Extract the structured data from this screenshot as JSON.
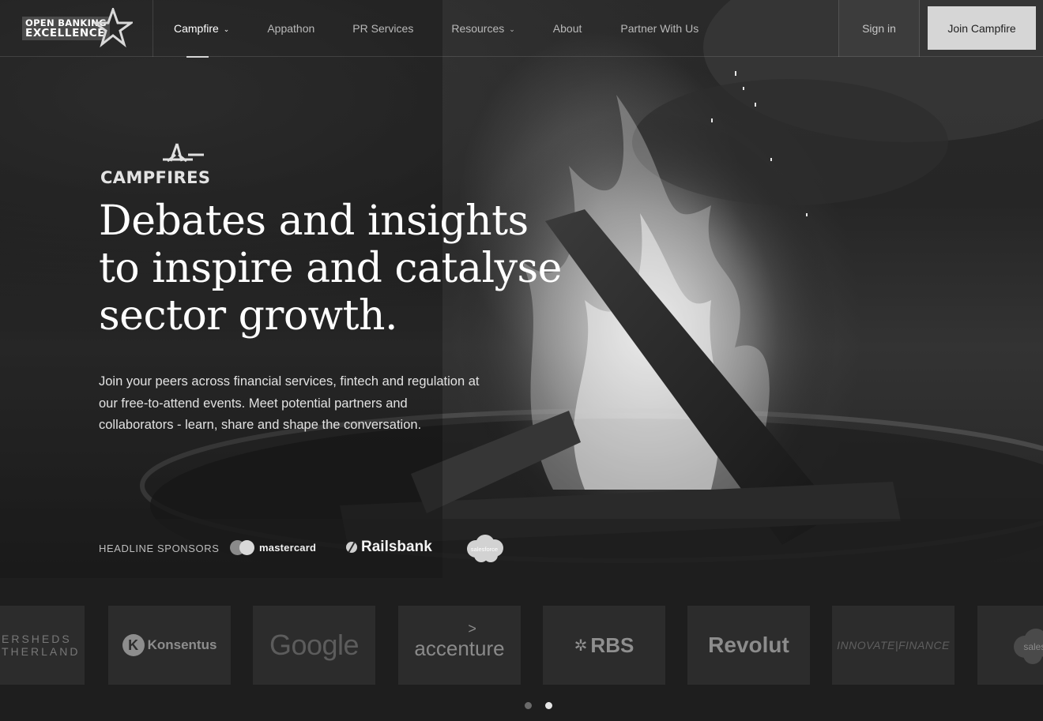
{
  "brand": {
    "line1": "OPEN BANKING",
    "line2": "EXCELLENCE"
  },
  "nav": {
    "items": [
      {
        "label": "Campfire",
        "has_dropdown": true,
        "active": true
      },
      {
        "label": "Appathon",
        "has_dropdown": false,
        "active": false
      },
      {
        "label": "PR Services",
        "has_dropdown": false,
        "active": false
      },
      {
        "label": "Resources",
        "has_dropdown": true,
        "active": false
      },
      {
        "label": "About",
        "has_dropdown": false,
        "active": false
      },
      {
        "label": "Partner With Us",
        "has_dropdown": false,
        "active": false
      }
    ],
    "chevron": "⌄",
    "sign_in": "Sign in",
    "join": "Join Campfire"
  },
  "hero": {
    "section_logo": "CAMPFIRES",
    "headline_lines": [
      "Debates and insights",
      "to inspire and catalyse",
      "sector growth."
    ],
    "lead_lines": [
      "Join your peers across financial services, fintech and regulation at",
      "our free-to-attend events. Meet potential partners and",
      "collaborators - learn, share and shape the conversation."
    ]
  },
  "sponsors": {
    "label": "HEADLINE SPONSORS",
    "items": [
      {
        "name": "mastercard",
        "icon": "mastercard-logo"
      },
      {
        "name": "Railsbank",
        "icon": "railsbank-logo"
      },
      {
        "name": "salesforce",
        "icon": "salesforce-cloud-logo"
      }
    ]
  },
  "partners": {
    "tiles": [
      {
        "name": "eversheds",
        "lines": [
          "ERSHEDS",
          "THERLAND"
        ]
      },
      {
        "name": "konsentus",
        "mark": "K",
        "text": "Konsentus"
      },
      {
        "name": "google",
        "text": "Google"
      },
      {
        "name": "accenture",
        "text": "accenture",
        "mark": ">"
      },
      {
        "name": "rbs",
        "mark": "✲",
        "text": "RBS"
      },
      {
        "name": "revolut",
        "text": "Revolut"
      },
      {
        "name": "innovate-finance",
        "text": "INNOVATE|FINANCE"
      },
      {
        "name": "salesforce",
        "text": "salesf"
      }
    ],
    "carousel_pages": 2,
    "active_page": 2
  },
  "colors": {
    "join_button_bg": "#d6d6d6",
    "page_bg": "#1e1e1e",
    "tile_bg": "#2c2c2c"
  }
}
